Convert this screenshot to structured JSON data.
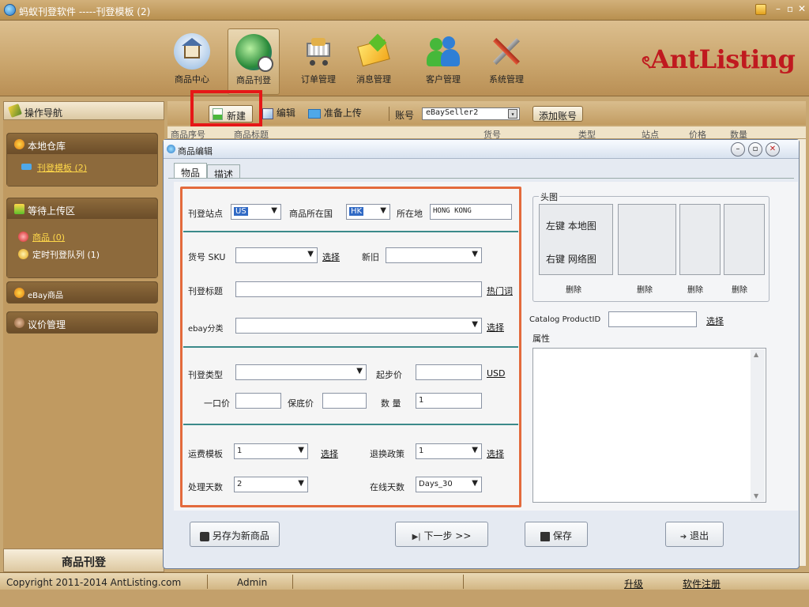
{
  "window": {
    "title": "蚂蚁刊登软件 -----刊登模板 (2)"
  },
  "nav": {
    "items": [
      {
        "label": "商品中心",
        "icon": "house-icon"
      },
      {
        "label": "商品刊登",
        "icon": "globe-clock-icon"
      },
      {
        "label": "订单管理",
        "icon": "shopping-cart-icon"
      },
      {
        "label": "消息管理",
        "icon": "envelope-icon"
      },
      {
        "label": "客户管理",
        "icon": "users-icon"
      },
      {
        "label": "系统管理",
        "icon": "tools-icon"
      }
    ],
    "logo": "AntListing"
  },
  "sidebar": {
    "header": "操作导航",
    "groups": [
      {
        "title": "本地仓库",
        "items": [
          {
            "label": "刊登模板 (2)"
          }
        ]
      },
      {
        "title": "等待上传区",
        "items": [
          {
            "label": "商品 (0)"
          },
          {
            "label": "定时刊登队列 (1)"
          }
        ]
      },
      {
        "title": "eBay商品",
        "items": []
      },
      {
        "title": "议价管理",
        "items": []
      }
    ],
    "footer": "商品刊登"
  },
  "toolbar": {
    "new": "新建",
    "edit": "编辑",
    "prepare": "准备上传",
    "account_label": "账号",
    "account_value": "eBaySeller2",
    "add_account": "添加账号"
  },
  "table_header": {
    "cols": [
      "商品序号",
      "商品标题",
      "货号",
      "类型",
      "站点",
      "价格",
      "数量"
    ]
  },
  "dialog": {
    "title": "商品编辑",
    "tabs": [
      "物品",
      "描述"
    ],
    "site_label": "刊登站点",
    "site_value": "US",
    "country_label": "商品所在国",
    "country_value": "HK",
    "location_label": "所在地",
    "location_value": "HONG KONG",
    "sku_label": "货号 SKU",
    "sku_select": "选择",
    "cond_label": "新旧",
    "title_label": "刊登标题",
    "hotword": "热门词",
    "category_label": "ebay分类",
    "category_select": "选择",
    "listtype_label": "刊登类型",
    "start_price_label": "起步价",
    "currency": "USD",
    "buynow_label": "一口价",
    "reserve_label": "保底价",
    "qty_label": "数 量",
    "qty_value": "1",
    "shipping_label": "运费模板",
    "shipping_value": "1",
    "shipping_select": "选择",
    "return_label": "退换政策",
    "return_value": "1",
    "return_select": "选择",
    "handling_label": "处理天数",
    "handling_value": "2",
    "duration_label": "在线天数",
    "duration_value": "Days_30",
    "head_image_label": "头图",
    "left_click": "左键 本地图",
    "right_click": "右键 网络图",
    "delete": "删除",
    "catalog_label": "Catalog ProductID",
    "catalog_select": "选择",
    "attr_label": "属性",
    "btn_saveas": "另存为新商品",
    "btn_next": "下一步 >>",
    "btn_save": "保存",
    "btn_exit": "退出"
  },
  "status": {
    "copyright": "Copyright 2011-2014  AntListing.com",
    "user": "Admin",
    "upgrade": "升级",
    "register": "软件注册"
  }
}
